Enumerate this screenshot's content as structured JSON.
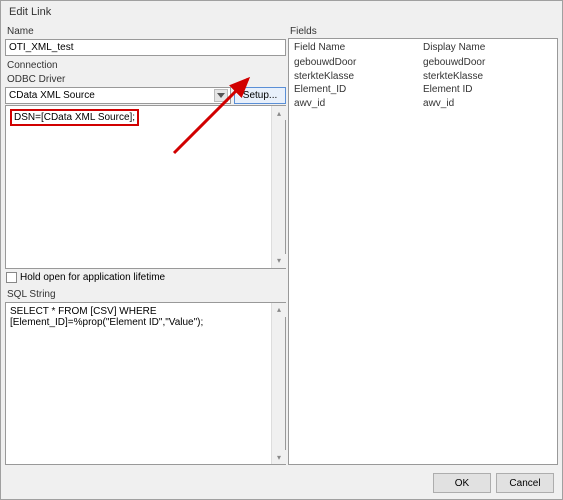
{
  "window": {
    "title": "Edit Link"
  },
  "left": {
    "name_label": "Name",
    "name_value": "OTI_XML_test",
    "connection_label": "Connection",
    "odbc_label": "ODBC Driver",
    "odbc_selected": "CData XML Source",
    "setup_btn": "Setup...",
    "conn_string": "DSN=[CData XML Source];",
    "hold_open_label": "Hold open for application lifetime",
    "sql_label": "SQL String",
    "sql_value": "SELECT * FROM [CSV] WHERE [Element_ID]=%prop(\"Element ID\",\"Value\");"
  },
  "right": {
    "fields_label": "Fields",
    "header_fieldname": "Field Name",
    "header_displayname": "Display Name",
    "rows": [
      {
        "field": "gebouwdDoor",
        "display": "gebouwdDoor"
      },
      {
        "field": "sterkteKlasse",
        "display": "sterkteKlasse"
      },
      {
        "field": "Element_ID",
        "display": "Element ID"
      },
      {
        "field": "awv_id",
        "display": "awv_id"
      }
    ]
  },
  "footer": {
    "ok": "OK",
    "cancel": "Cancel"
  }
}
